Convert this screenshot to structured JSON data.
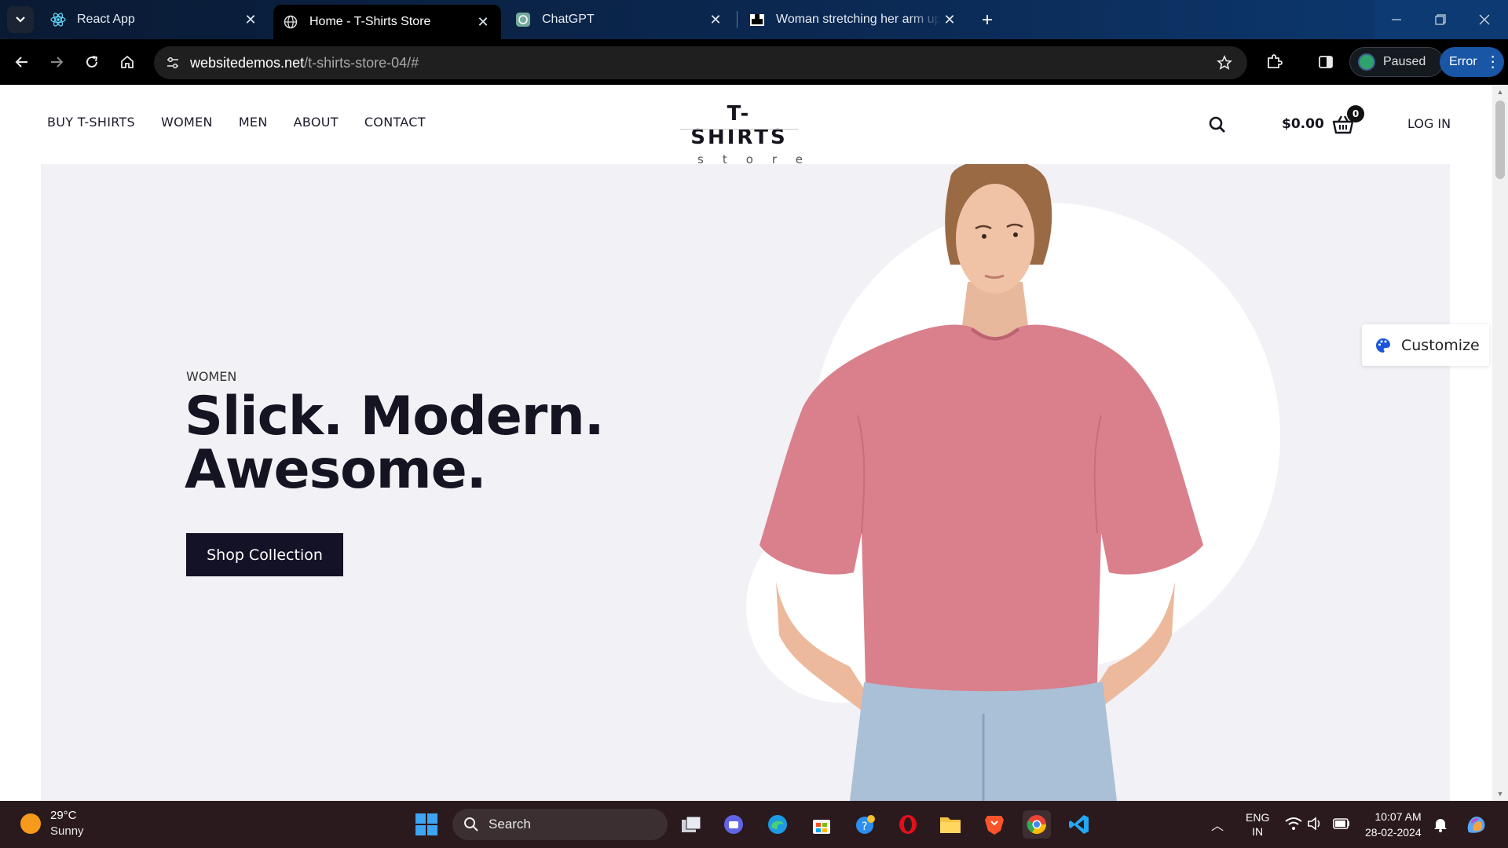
{
  "browser": {
    "tabs": [
      {
        "title": "React App",
        "active": false,
        "icon": "react-icon"
      },
      {
        "title": "Home - T-Shirts Store",
        "active": true,
        "icon": "globe-icon"
      },
      {
        "title": "ChatGPT",
        "active": false,
        "icon": "chatgpt-icon"
      },
      {
        "title": "Woman stretching her arm upw",
        "active": false,
        "icon": "image-site-icon"
      }
    ],
    "url_host": "websitedemos.net",
    "url_path": "/t-shirts-store-04/#",
    "profile_label": "Paused",
    "error_label": "Error"
  },
  "site": {
    "nav": [
      "BUY T-SHIRTS",
      "WOMEN",
      "MEN",
      "ABOUT",
      "CONTACT"
    ],
    "logo_line1": "T-SHIRTS",
    "logo_line2": "store",
    "cart_total": "$0.00",
    "cart_count": "0",
    "login": "LOG IN",
    "customize": "Customize"
  },
  "hero": {
    "eyebrow": "WOMEN",
    "title_line1": "Slick. Modern.",
    "title_line2": "Awesome.",
    "cta": "Shop Collection"
  },
  "taskbar": {
    "temperature": "29°C",
    "condition": "Sunny",
    "search_label": "Search",
    "lang_line1": "ENG",
    "lang_line2": "IN",
    "time": "10:07 AM",
    "date": "28-02-2024"
  },
  "colors": {
    "hero_bg": "#f2f1f5",
    "cta_bg": "#141226",
    "tshirt": "#d9808c",
    "active_tab": "#000000",
    "error_pill": "#1a56a6"
  }
}
